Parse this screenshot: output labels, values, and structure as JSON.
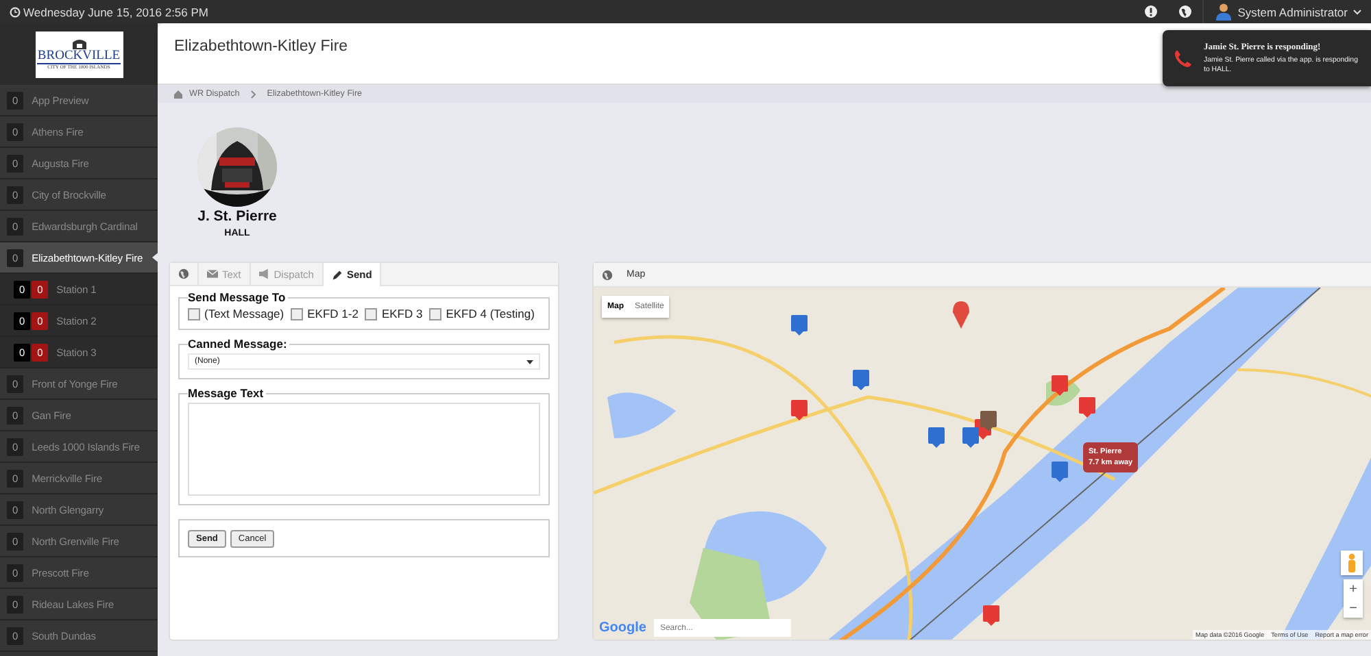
{
  "top_bar": {
    "datetime": "Wednesday June 15, 2016 2:56 PM",
    "user": "System Administrator"
  },
  "logo": {
    "name": "BROCKVILLE",
    "tagline": "CITY OF THE 1000 ISLANDS"
  },
  "sidebar": {
    "items": [
      {
        "count": "0",
        "label": "App Preview",
        "selected": false
      },
      {
        "count": "0",
        "label": "Athens Fire",
        "selected": false
      },
      {
        "count": "0",
        "label": "Augusta Fire",
        "selected": false
      },
      {
        "count": "0",
        "label": "City of Brockville",
        "selected": false
      },
      {
        "count": "0",
        "label": "Edwardsburgh Cardinal",
        "selected": false
      },
      {
        "count": "0",
        "label": "Elizabethtown-Kitley Fire",
        "selected": true,
        "children": [
          {
            "count": "0",
            "alert_count": "0",
            "label": "Station 1",
            "selected": false
          },
          {
            "count": "0",
            "alert_count": "0",
            "label": "Station 2",
            "selected": false
          },
          {
            "count": "0",
            "alert_count": "0",
            "label": "Station 3",
            "selected": false
          }
        ]
      },
      {
        "count": "0",
        "label": "Front of Yonge Fire",
        "selected": false
      },
      {
        "count": "0",
        "label": "Gan Fire",
        "selected": false
      },
      {
        "count": "0",
        "label": "Leeds 1000 Islands Fire",
        "selected": false
      },
      {
        "count": "0",
        "label": "Merrickville Fire",
        "selected": false
      },
      {
        "count": "0",
        "label": "North Glengarry",
        "selected": false
      },
      {
        "count": "0",
        "label": "North Grenville Fire",
        "selected": false
      },
      {
        "count": "0",
        "label": "Prescott Fire",
        "selected": false
      },
      {
        "count": "0",
        "label": "Rideau Lakes Fire",
        "selected": false
      },
      {
        "count": "0",
        "label": "South Dundas",
        "selected": false
      }
    ]
  },
  "page": {
    "title": "Elizabethtown-Kitley Fire",
    "breadcrumb": [
      "WR Dispatch",
      "Elizabethtown-Kitley Fire"
    ]
  },
  "notification": {
    "title": "Jamie St. Pierre is responding!",
    "message": "Jamie St. Pierre called via the app. is responding to HALL."
  },
  "profile": {
    "name": "J. St. Pierre",
    "location": "HALL"
  },
  "message_panel": {
    "tabs": [
      {
        "kind": "globe",
        "selected": false
      },
      {
        "kind": "envelope",
        "label": "Text",
        "selected": false
      },
      {
        "kind": "megaphone",
        "label": "Dispatch",
        "selected": false
      },
      {
        "kind": "pencil",
        "label": "Send",
        "selected": true
      }
    ],
    "send_to": {
      "legend": "Send Message To",
      "recipients": [
        {
          "label": "(Text Message)",
          "checked": false
        },
        {
          "label": "EKFD 1-2",
          "checked": false
        },
        {
          "label": "EKFD 3",
          "checked": false
        },
        {
          "label": "EKFD 4 (Testing)",
          "checked": false
        }
      ]
    },
    "canned_message": {
      "legend": "Canned Message:",
      "value": "(None)"
    },
    "message_text": {
      "legend": "Message Text"
    },
    "buttons": [
      "Send",
      "Cancel"
    ]
  },
  "map_panel": {
    "title": "Map",
    "map_types": [
      {
        "label": "Map",
        "selected": true
      },
      {
        "label": "Satellite",
        "selected": false
      }
    ],
    "callout": {
      "name": "St. Pierre",
      "distance": "7.7 km away"
    },
    "search": {
      "placeholder": "Search..."
    },
    "provider": "Google",
    "zoom_in": "+",
    "zoom_out": "−",
    "attribution": "Map data ©2016 Google",
    "links": [
      "Terms of Use",
      "Report a map error"
    ]
  }
}
